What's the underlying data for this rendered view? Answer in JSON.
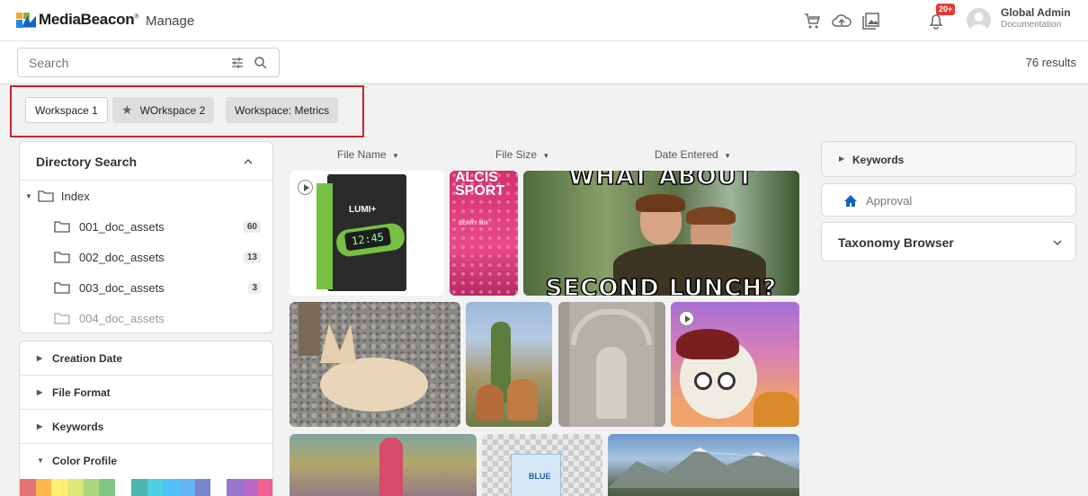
{
  "header": {
    "brand": "MediaBeacon",
    "section": "Manage",
    "notification_count": "20+",
    "user_name": "Global Admin",
    "user_role": "Documentation",
    "icons": [
      "cart-icon",
      "upload-icon",
      "gallery-icon",
      "bell-icon",
      "user-avatar-icon"
    ]
  },
  "search": {
    "placeholder": "Search",
    "results": "76 results"
  },
  "workspaces": [
    {
      "label": "Workspace 1",
      "active": true
    },
    {
      "label": "WOrkspace 2",
      "starred": true
    },
    {
      "label": "Workspace: Metrics"
    }
  ],
  "directory": {
    "title": "Directory Search",
    "root": "Index",
    "folders": [
      {
        "name": "001_doc_assets",
        "count": "60"
      },
      {
        "name": "002_doc_assets",
        "count": "13"
      },
      {
        "name": "003_doc_assets",
        "count": "3"
      },
      {
        "name": "004_doc_assets",
        "count": ""
      }
    ]
  },
  "facets": [
    {
      "label": "Creation Date",
      "expanded": false
    },
    {
      "label": "File Format",
      "expanded": false
    },
    {
      "label": "Keywords",
      "expanded": false
    },
    {
      "label": "Color Profile",
      "expanded": true
    }
  ],
  "color_swatches": [
    "#e57373",
    "#ffb74d",
    "#fff176",
    "#dce775",
    "#aed581",
    "#81c784",
    "#ffffff",
    "#4db6ac",
    "#4dd0e1",
    "#4fc3f7",
    "#64b5f6",
    "#7986cb",
    "#ffffff",
    "#9575cd",
    "#ba68c8",
    "#f06292"
  ],
  "columns": {
    "file_name": "File Name",
    "file_size": "File Size",
    "date_entered": "Date Entered"
  },
  "thumbnails": {
    "lumi_brand": "LUMI+",
    "lumi_time": "12:45",
    "alcis_line1": "ALCIS",
    "alcis_line2": "SPORT",
    "alcis_line3": "BERRY MIX",
    "meme_top": "WHAT ABOUT",
    "meme_bottom": "SECOND LUNCH?",
    "blue_label": "BLUE"
  },
  "right_panel": {
    "keywords": "Keywords",
    "approval": "Approval",
    "taxonomy": "Taxonomy Browser"
  },
  "colors": {
    "brand_blue": "#1565c0",
    "accent_red": "#c62828",
    "badge_red": "#e53935"
  }
}
